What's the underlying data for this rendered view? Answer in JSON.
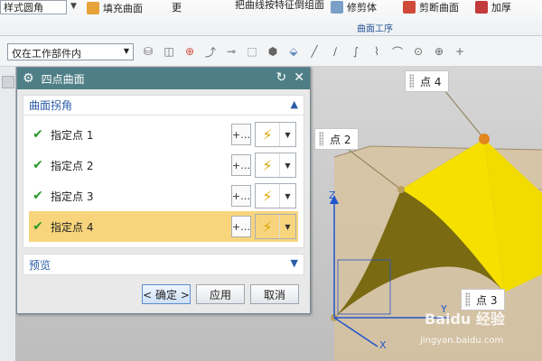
{
  "ribbon": {
    "style_combo": "样式圆角",
    "fill_surface": "填充曲面",
    "cut_text": "把曲线按特征倒组面",
    "trim_body": "修剪体",
    "split_surface": "剪断曲面",
    "thicken": "加厚",
    "group_label": "曲面工序"
  },
  "toolbar": {
    "filter_combo": "仅在工作部件内"
  },
  "dialog": {
    "title": "四点曲面",
    "section_corners": "曲面拐角",
    "rows": [
      {
        "label": "指定点 1",
        "state": "done"
      },
      {
        "label": "指定点 2",
        "state": "done"
      },
      {
        "label": "指定点 3",
        "state": "done"
      },
      {
        "label": "指定点 4",
        "state": "active"
      }
    ],
    "section_preview": "预览",
    "ok": "< 确定 >",
    "apply": "应用",
    "cancel": "取消"
  },
  "viewport": {
    "callouts": [
      "点 4",
      "点 2",
      "点 3"
    ],
    "axis_z": "Z",
    "axis_y": "Y",
    "axis_x": "X",
    "watermark": "Baidu 经验",
    "watermark_url": "jingyan.baidu.com"
  },
  "colors": {
    "title_bar": "#4f7f86",
    "active_row": "#f8d57c",
    "surface_yellow": "#f5e000",
    "surface_dark": "#7a6a12",
    "box_tan": "#d9c29a"
  }
}
